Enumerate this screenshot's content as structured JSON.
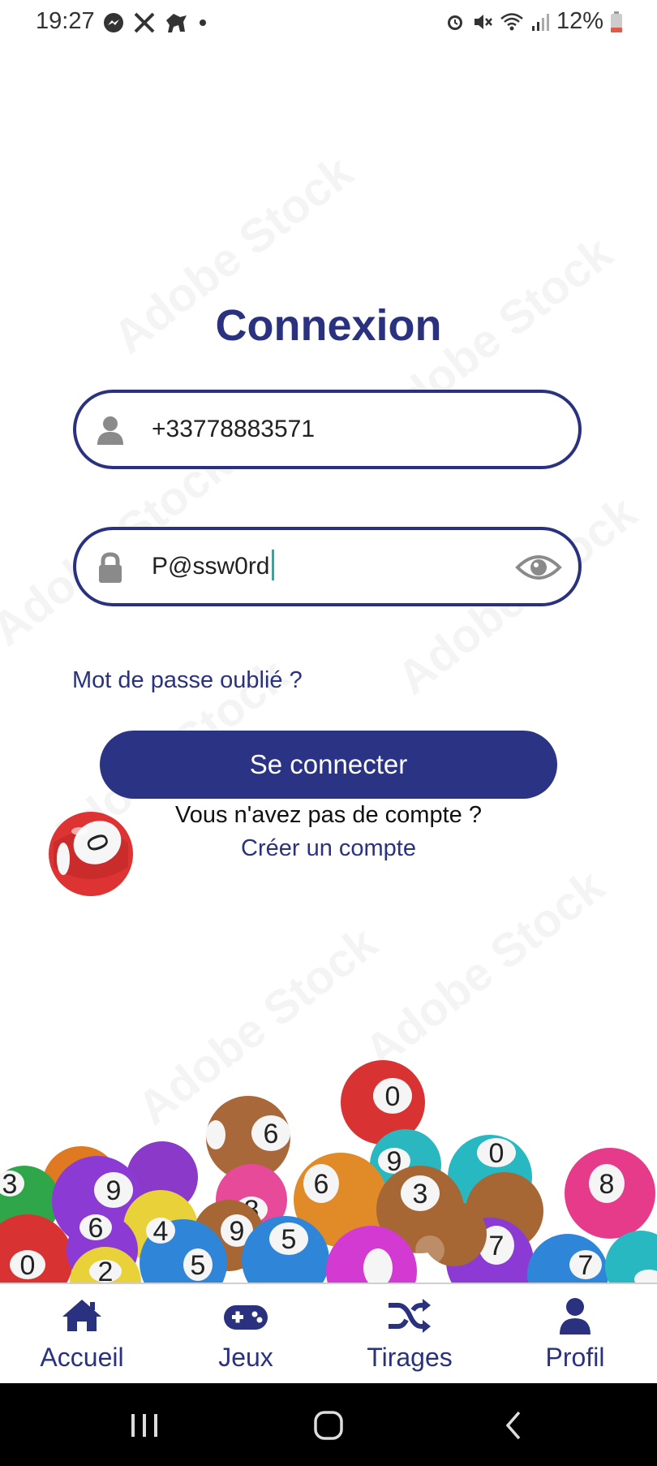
{
  "status": {
    "time": "19:27",
    "battery": "12%",
    "left_icons": [
      "messenger-icon",
      "x-icon",
      "notification-icon",
      "dot-icon"
    ],
    "right_icons": [
      "alarm-icon",
      "mute-icon",
      "wifi-icon",
      "signal-icon",
      "battery-icon"
    ]
  },
  "watermark": "Adobe Stock",
  "login": {
    "title": "Connexion",
    "phone_value": "+33778883571",
    "password_value": "P@ssw0rd",
    "forgot_password": "Mot de passe oublié ?",
    "submit_label": "Se connecter",
    "no_account_text": "Vous n'avez pas de compte ?",
    "create_account": "Créer un compte"
  },
  "colors": {
    "primary": "#2a3280",
    "button": "#2b3385",
    "caret": "#12b6a6"
  },
  "bottom_nav": {
    "items": [
      {
        "label": "Accueil",
        "icon": "home-icon"
      },
      {
        "label": "Jeux",
        "icon": "gamepad-icon"
      },
      {
        "label": "Tirages",
        "icon": "shuffle-icon"
      },
      {
        "label": "Profil",
        "icon": "user-icon"
      }
    ]
  },
  "balls": [
    "0",
    "6",
    "9",
    "6",
    "3",
    "6",
    "9",
    "7",
    "0",
    "8",
    "5",
    "8",
    "4",
    "5",
    "9",
    "3",
    "7",
    "5",
    "8",
    "2",
    "0",
    "4"
  ],
  "system_nav": {
    "buttons": [
      "recent-apps-icon",
      "home-circle-icon",
      "back-icon"
    ]
  }
}
